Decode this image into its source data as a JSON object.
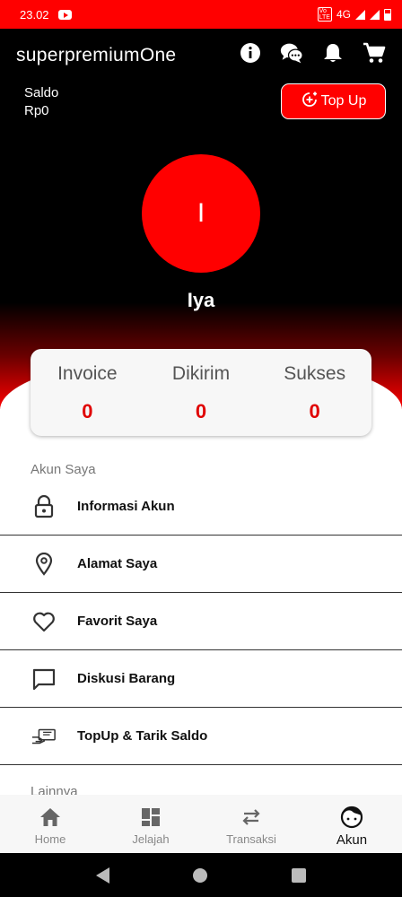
{
  "status_bar": {
    "time": "23.02",
    "network": "4G",
    "volte": "VoLTE"
  },
  "header": {
    "title": "superpremiumOne",
    "saldo_label": "Saldo",
    "saldo_value": "Rp0",
    "topup_label": "Top Up",
    "icons": [
      "info-icon",
      "chat-icon",
      "bell-icon",
      "cart-icon"
    ]
  },
  "profile": {
    "initial": "I",
    "name": "Iya"
  },
  "stats": [
    {
      "label": "Invoice",
      "value": "0"
    },
    {
      "label": "Dikirim",
      "value": "0"
    },
    {
      "label": "Sukses",
      "value": "0"
    }
  ],
  "sections": {
    "account_title": "Akun Saya",
    "other_title": "Lainnya"
  },
  "menu": [
    {
      "label": "Informasi Akun",
      "icon": "lock-icon"
    },
    {
      "label": "Alamat Saya",
      "icon": "location-pin-icon"
    },
    {
      "label": "Favorit Saya",
      "icon": "heart-icon"
    },
    {
      "label": "Diskusi Barang",
      "icon": "chat-bubble-icon"
    },
    {
      "label": "TopUp & Tarik Saldo",
      "icon": "hand-money-icon"
    }
  ],
  "bottom_nav": [
    {
      "label": "Home",
      "icon": "home-icon"
    },
    {
      "label": "Jelajah",
      "icon": "dashboard-icon"
    },
    {
      "label": "Transaksi",
      "icon": "swap-icon"
    },
    {
      "label": "Akun",
      "icon": "face-icon",
      "active": true
    }
  ],
  "colors": {
    "accent": "#ff0000",
    "header_bg": "#000000",
    "stat_value": "#e00000"
  }
}
